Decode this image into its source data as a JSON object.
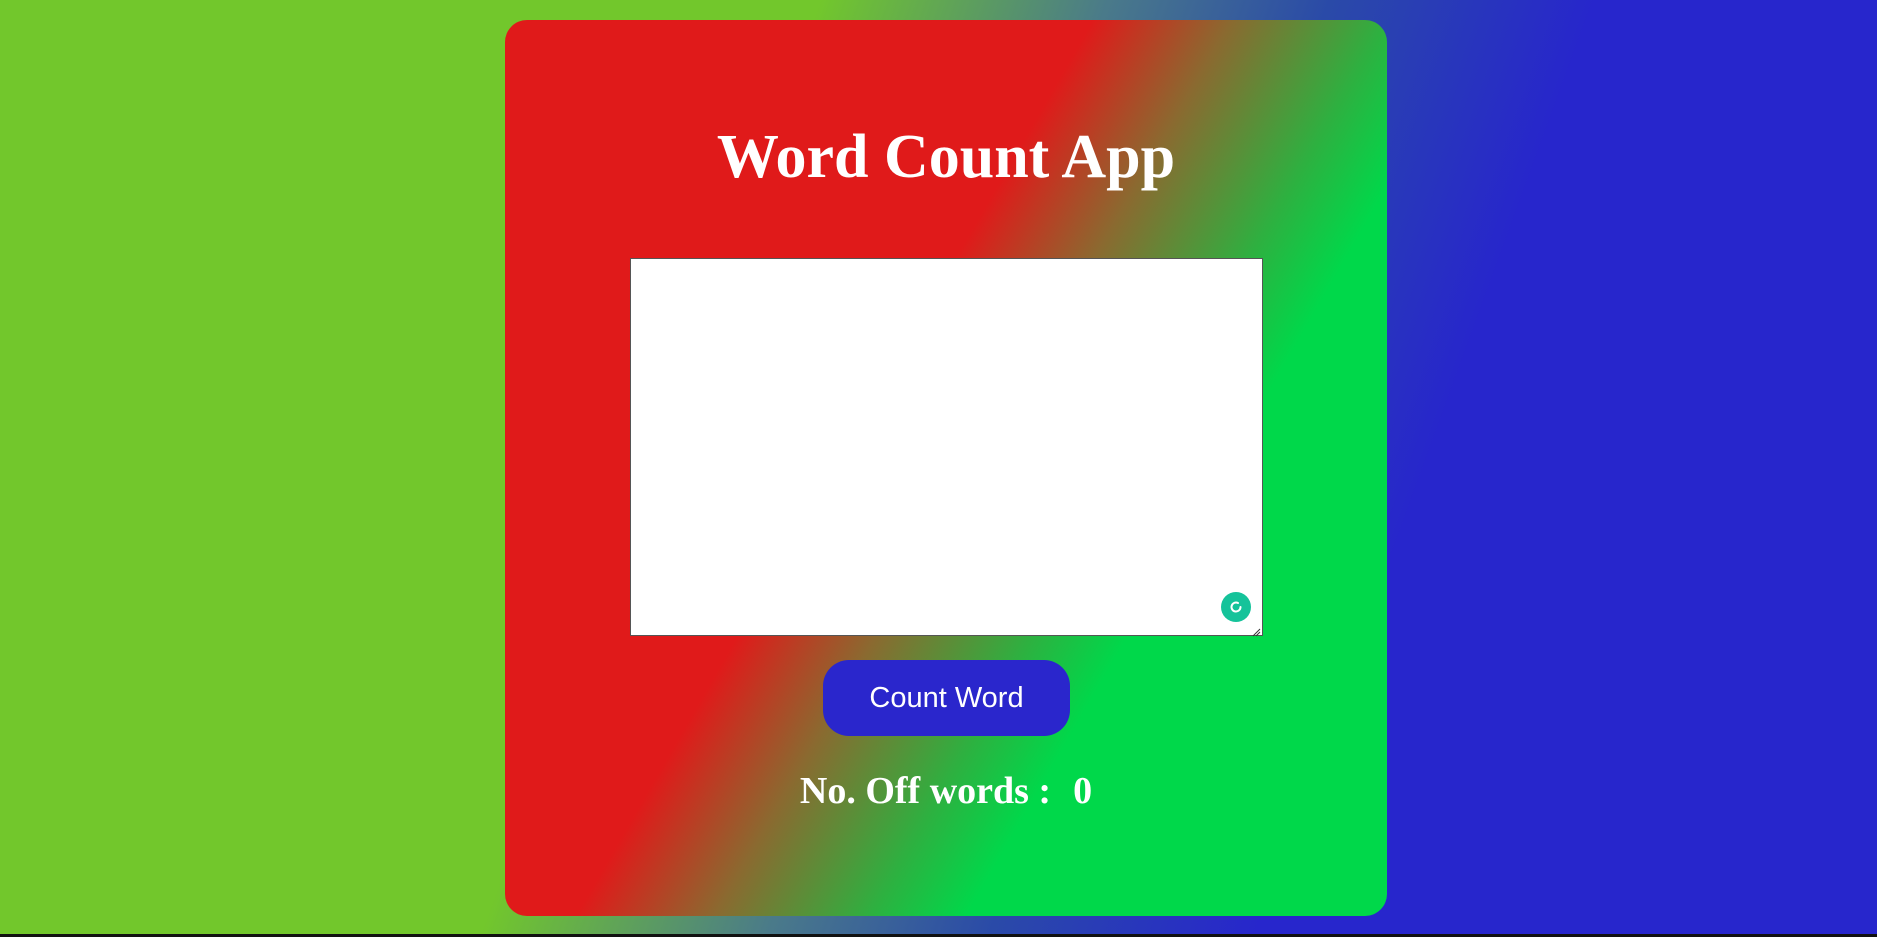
{
  "app": {
    "title": "Word Count App"
  },
  "input": {
    "value": "",
    "placeholder": ""
  },
  "actions": {
    "count_label": "Count Word"
  },
  "result": {
    "label": "No. Off words :",
    "count": "0"
  },
  "icons": {
    "grammar": "grammarly-icon",
    "resize": "resize-handle-icon"
  },
  "colors": {
    "button": "#2a26cc",
    "card_red": "#e01a1a",
    "card_green": "#00d84a",
    "bg_green": "#72c72c",
    "bg_blue": "#2726cc",
    "grammar_icon": "#15c39a"
  }
}
